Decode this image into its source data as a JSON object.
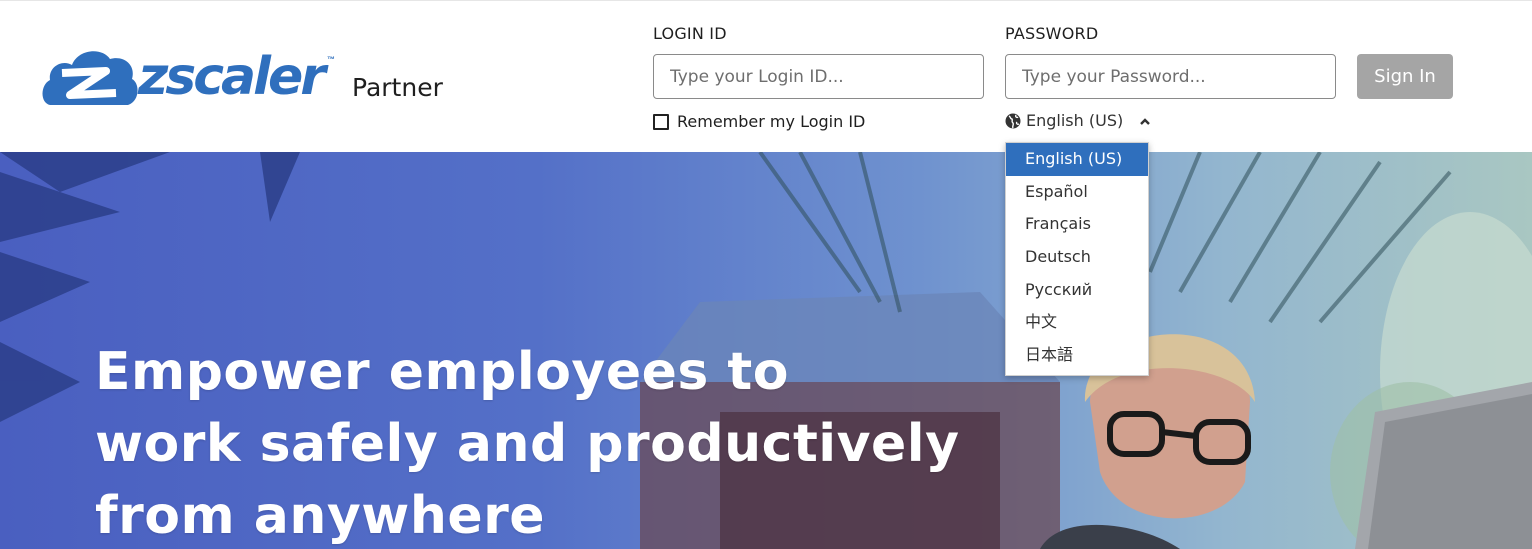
{
  "brand": {
    "logo_text": "zscaler",
    "trademark": "™",
    "product": "Partner",
    "color": "#2f6fbd"
  },
  "login": {
    "login_id_label": "LOGIN ID",
    "login_id_placeholder": "Type your Login ID...",
    "login_id_value": "",
    "password_label": "PASSWORD",
    "password_placeholder": "Type your Password...",
    "password_value": "",
    "signin_label": "Sign In",
    "remember_label": "Remember my Login ID",
    "remember_checked": false
  },
  "language": {
    "current": "English (US)",
    "globe_icon": "globe-icon",
    "toggle_icon": "chevron-up-icon",
    "options": [
      {
        "label": "English (US)",
        "selected": true
      },
      {
        "label": "Español",
        "selected": false
      },
      {
        "label": "Français",
        "selected": false
      },
      {
        "label": "Deutsch",
        "selected": false
      },
      {
        "label": "Русский",
        "selected": false
      },
      {
        "label": "中文",
        "selected": false
      },
      {
        "label": "日本語",
        "selected": false
      }
    ]
  },
  "hero": {
    "headline_lines": [
      "Empower employees to",
      "work safely and productively",
      "from anywhere"
    ]
  }
}
